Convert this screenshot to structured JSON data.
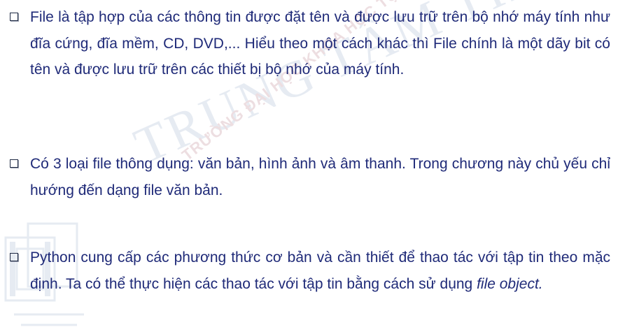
{
  "watermark": {
    "center_text": "TRUNG TÂM TIN HỌC",
    "arc_text": "TRƯỜNG ĐẠI HỌC KHOA HỌC TỰ NHIÊN",
    "colors": {
      "center": "#8fa6c8",
      "arc": "#b06f7a"
    },
    "logo_icon": "institution-logo-icon"
  },
  "text_color": "#1f2a78",
  "bullets": [
    {
      "icon": "checkbox-bullet-icon",
      "text": "File là tập hợp của các thông tin được đặt tên và được lưu trữ trên bộ nhớ máy tính như đĩa cứng, đĩa mềm, CD, DVD,... Hiểu theo một cách khác thì File chính là một dãy bit có tên và được lưu trữ trên các thiết bị bộ nhớ của máy tính."
    },
    {
      "icon": "checkbox-bullet-icon",
      "text": "Có 3 loại file thông dụng: văn bản, hình ảnh và âm thanh. Trong chương này chủ yếu chỉ hướng đến dạng file văn bản."
    },
    {
      "icon": "checkbox-bullet-icon",
      "text_before": "Python cung cấp các phương thức cơ bản và cần thiết để thao tác với tập tin theo mặc định. Ta có thể thực hiện các thao tác với tập tin bằng cách sử dụng ",
      "text_italic": "file object.",
      "text_after": ""
    }
  ]
}
